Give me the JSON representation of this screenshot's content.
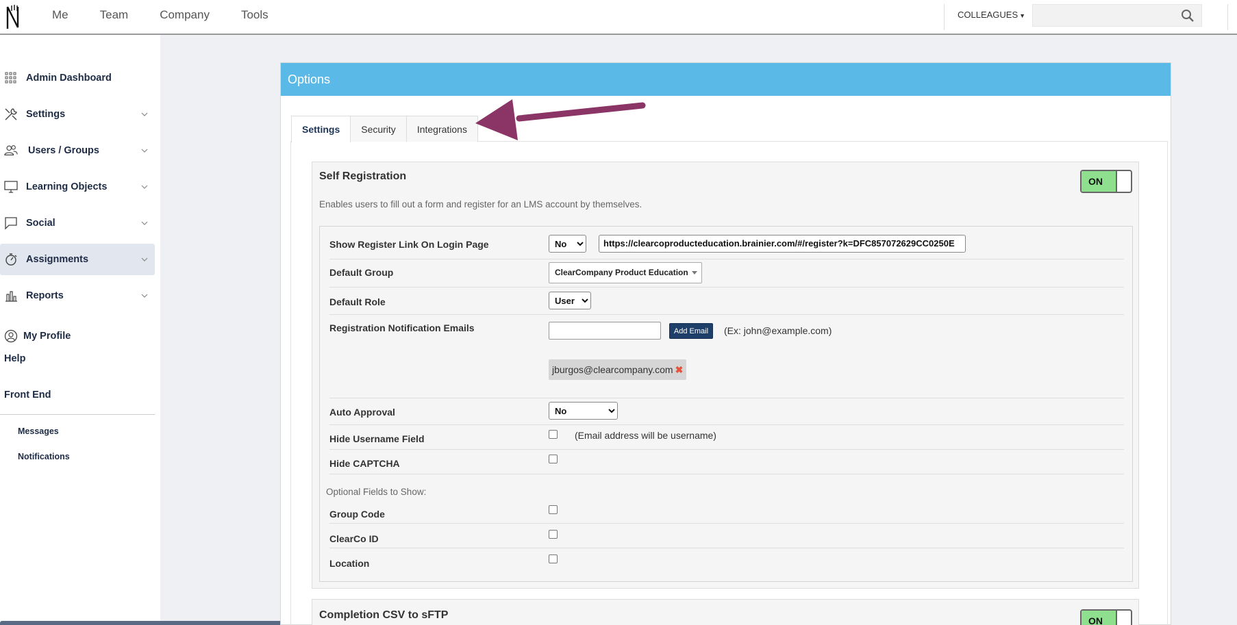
{
  "topnav": {
    "items": [
      "Me",
      "Team",
      "Company",
      "Tools"
    ],
    "colleagues_label": "COLLEAGUES",
    "search_placeholder": ""
  },
  "sidebar": {
    "items": [
      {
        "label": "Admin Dashboard",
        "icon": "grid-icon",
        "chevron": false
      },
      {
        "label": "Settings",
        "icon": "tools-icon",
        "chevron": true
      },
      {
        "label": "Users / Groups",
        "icon": "users-icon",
        "chevron": true
      },
      {
        "label": "Learning Objects",
        "icon": "monitor-icon",
        "chevron": true
      },
      {
        "label": "Social",
        "icon": "chat-icon",
        "chevron": true
      },
      {
        "label": "Assignments",
        "icon": "stopwatch-icon",
        "chevron": true,
        "active": true
      },
      {
        "label": "Reports",
        "icon": "bar-chart-icon",
        "chevron": true
      }
    ],
    "my_profile": "My Profile",
    "help": "Help",
    "front_end": "Front End",
    "messages": "Messages",
    "notifications": "Notifications"
  },
  "panel": {
    "title": "Options",
    "tabs": [
      "Settings",
      "Security",
      "Integrations"
    ],
    "active_tab": "Settings"
  },
  "self_registration": {
    "title": "Self Registration",
    "toggle": "ON",
    "description": "Enables users to fill out a form and register for an LMS account by themselves.",
    "show_register_link": {
      "label": "Show Register Link On Login Page",
      "value": "No",
      "url": "https://clearcoproducteducation.brainier.com/#/register?k=DFC857072629CC0250E"
    },
    "default_group": {
      "label": "Default Group",
      "value": "ClearCompany Product Education"
    },
    "default_role": {
      "label": "Default Role",
      "value": "User"
    },
    "notification_emails": {
      "label": "Registration Notification Emails",
      "add_button": "Add Email",
      "example": "(Ex: john@example.com)",
      "emails": [
        "jburgos@clearcompany.com"
      ]
    },
    "auto_approval": {
      "label": "Auto Approval",
      "value": "No"
    },
    "hide_username": {
      "label": "Hide Username Field",
      "hint": "(Email address will be username)"
    },
    "hide_captcha": {
      "label": "Hide CAPTCHA"
    },
    "optional_heading": "Optional Fields to Show:",
    "optional_fields": [
      "Group Code",
      "ClearCo ID",
      "Location"
    ]
  },
  "completion_csv": {
    "title": "Completion CSV to sFTP",
    "toggle": "ON"
  },
  "colors": {
    "header_blue": "#5bb9e8",
    "toggle_green": "#8ee08e",
    "arrow": "#8a3566",
    "button_navy": "#1f3f6b"
  }
}
